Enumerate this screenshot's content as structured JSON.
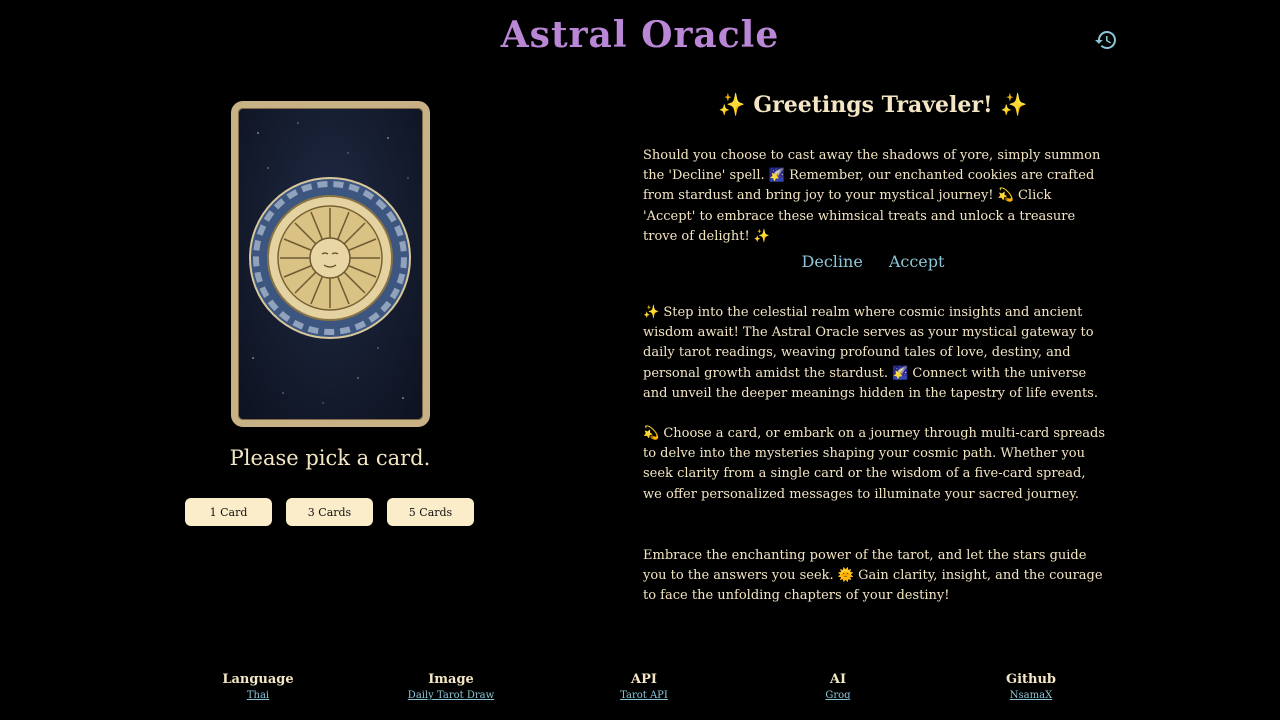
{
  "header": {
    "title": "Astral Oracle",
    "history_icon": "history-icon"
  },
  "card_panel": {
    "prompt": "Please pick a card.",
    "spread_buttons": [
      "1 Card",
      "3 Cards",
      "5 Cards"
    ]
  },
  "consent": {
    "greeting": "✨ Greetings Traveler! ✨",
    "message": "Should you choose to cast away the shadows of yore, simply summon the 'Decline' spell. 🌠 Remember, our enchanted cookies are crafted from stardust and bring joy to your mystical journey! 💫 Click 'Accept' to embrace these whimsical treats and unlock a treasure trove of delight! ✨",
    "decline_label": "Decline",
    "accept_label": "Accept"
  },
  "about": {
    "paragraphs": [
      "✨ Step into the celestial realm where cosmic insights and ancient wisdom await! The Astral Oracle serves as your mystical gateway to daily tarot readings, weaving profound tales of love, destiny, and personal growth amidst the stardust. 🌠 Connect with the universe and unveil the deeper meanings hidden in the tapestry of life events.",
      "💫 Choose a card, or embark on a journey through multi-card spreads to delve into the mysteries shaping your cosmic path. Whether you seek clarity from a single card or the wisdom of a five-card spread, we offer personalized messages to illuminate your sacred journey.",
      "Embrace the enchanting power of the tarot, and let the stars guide you to the answers you seek. 🌞 Gain clarity, insight, and the courage to face the unfolding chapters of your destiny!"
    ]
  },
  "footer": [
    {
      "heading": "Language",
      "link": "Thai"
    },
    {
      "heading": "Image",
      "link": "Daily Tarot Draw"
    },
    {
      "heading": "API",
      "link": "Tarot API"
    },
    {
      "heading": "AI",
      "link": "Groq"
    },
    {
      "heading": "Github",
      "link": "NsamaX"
    }
  ],
  "colors": {
    "background": "#000000",
    "title": "#b987d6",
    "text": "#f4e6c4",
    "link": "#8cc6d8",
    "button_bg": "#fbedc9",
    "card_border": "#c9b186"
  }
}
